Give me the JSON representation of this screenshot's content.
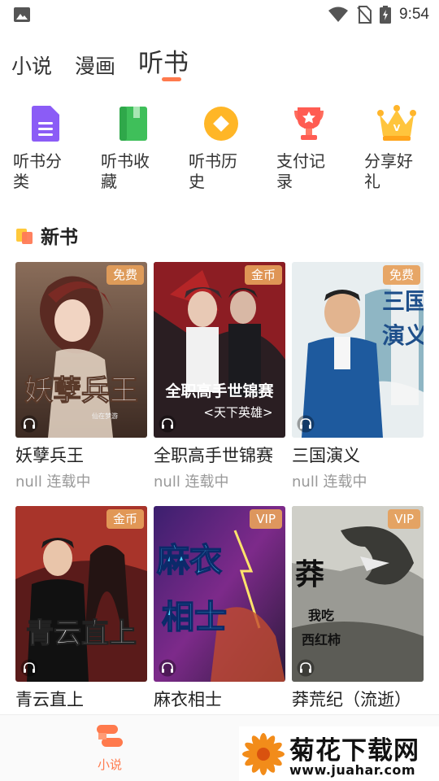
{
  "status_bar": {
    "time": "9:54"
  },
  "top_tabs": [
    "小说",
    "漫画",
    "听书"
  ],
  "quick_nav": [
    {
      "label": "听书分类",
      "icon": "document-icon",
      "color": "#8b5cf6"
    },
    {
      "label": "听书收藏",
      "icon": "book-icon",
      "color": "#3fbf5a"
    },
    {
      "label": "听书历史",
      "icon": "clock-circle-icon",
      "color": "#ffb627"
    },
    {
      "label": "支付记录",
      "icon": "trophy-icon",
      "color": "#ff5c52"
    },
    {
      "label": "分享好礼",
      "icon": "crown-icon",
      "color": "#ffb52b"
    }
  ],
  "section": {
    "title": "新书"
  },
  "books": [
    {
      "title": "妖孽兵王",
      "subtitle": "null 连载中",
      "badge": "免费",
      "cover_text": "妖孽兵王",
      "author_tag": "仙在梦游"
    },
    {
      "title": "全职高手世锦赛",
      "subtitle": "null 连载中",
      "badge": "金币",
      "cover_text": "全职高手世锦赛",
      "cover_text2": "<天下英雄>"
    },
    {
      "title": "三国演义",
      "subtitle": "null 连载中",
      "badge": "免费",
      "cover_text": "三国演义"
    },
    {
      "title": "青云直上",
      "subtitle": "",
      "badge": "金币",
      "cover_text": "青云直上"
    },
    {
      "title": "麻衣相士",
      "subtitle": "",
      "badge": "VIP",
      "cover_text": "麻衣相士"
    },
    {
      "title": "莽荒纪（流逝）",
      "subtitle": "",
      "badge": "VIP",
      "cover_text": "莽荒纪"
    }
  ],
  "bottom_nav": {
    "label": "小说",
    "accent": "#ff7a4d"
  },
  "watermark": {
    "title": "菊花下载网",
    "url": "www.juahar.com"
  }
}
